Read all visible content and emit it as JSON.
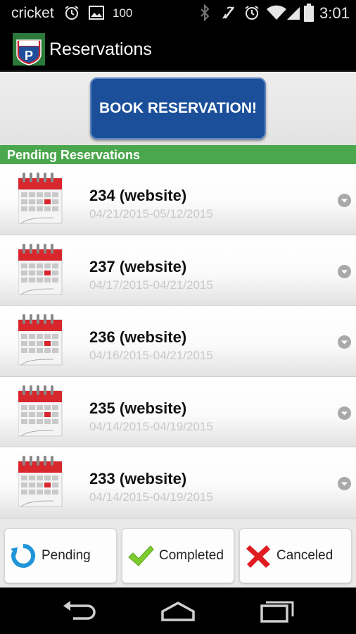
{
  "status_bar": {
    "carrier": "cricket",
    "battery_percent": "100",
    "time": "3:01",
    "icons": [
      "alarm-icon",
      "gallery-icon",
      "bluetooth-icon",
      "mute-icon",
      "alarm-icon",
      "wifi-icon",
      "signal-icon",
      "battery-icon"
    ]
  },
  "action_bar": {
    "title": "Reservations",
    "logo_icon": "parking-logo-icon"
  },
  "book_button": {
    "label": "BOOK RESERVATION!"
  },
  "section": {
    "title": "Pending Reservations"
  },
  "reservations": [
    {
      "title": "234 (website)",
      "dates": "04/21/2015-05/12/2015"
    },
    {
      "title": "237 (website)",
      "dates": "04/17/2015-04/21/2015"
    },
    {
      "title": "236 (website)",
      "dates": "04/16/2015-04/21/2015"
    },
    {
      "title": "235 (website)",
      "dates": "04/14/2015-04/19/2015"
    },
    {
      "title": "233 (website)",
      "dates": "04/14/2015-04/19/2015"
    }
  ],
  "tabs": [
    {
      "label": "Pending",
      "icon": "refresh-icon"
    },
    {
      "label": "Completed",
      "icon": "checkmark-icon"
    },
    {
      "label": "Canceled",
      "icon": "x-icon"
    }
  ],
  "colors": {
    "book_button": "#1b4f99",
    "section_header": "#4aa74c",
    "date_text": "#c8c8c8"
  }
}
